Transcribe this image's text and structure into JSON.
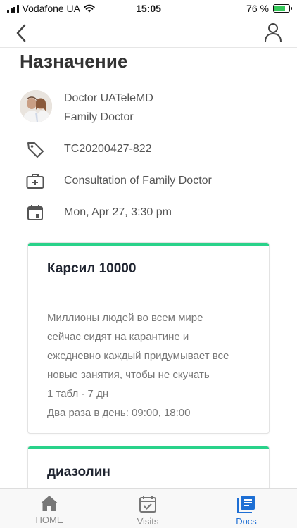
{
  "status_bar": {
    "carrier": "Vodafone UA",
    "time": "15:05",
    "battery_percent": "76 %",
    "battery_level": 0.76
  },
  "nav": {
    "back_icon": "chevron-left-icon",
    "profile_icon": "user-icon"
  },
  "page": {
    "title": "Назначение"
  },
  "appointment": {
    "doctor_name": "Doctor UATeleMD",
    "doctor_role": "Family Doctor",
    "code": "TC20200427-822",
    "service": "Consultation of Family Doctor",
    "datetime": "Mon, Apr 27, 3:30 pm"
  },
  "prescriptions": [
    {
      "title": "Карсил 10000",
      "description_lines": [
        "Миллионы людей во всем мире",
        "сейчас сидят на карантине и",
        "ежедневно каждый придумывает все",
        "новые занятия, чтобы не скучать"
      ],
      "dosage": "1 табл - 7 дн",
      "schedule": "Два раза в день: 09:00, 18:00"
    },
    {
      "title": "диазолин"
    }
  ],
  "tabs": [
    {
      "label": "HOME",
      "icon": "home-icon"
    },
    {
      "label": "Visits",
      "icon": "calendar-check-icon"
    },
    {
      "label": "Docs",
      "icon": "documents-icon"
    }
  ],
  "colors": {
    "accent": "#29d28a",
    "active_tab": "#1e6fd4",
    "battery": "#35c759"
  }
}
